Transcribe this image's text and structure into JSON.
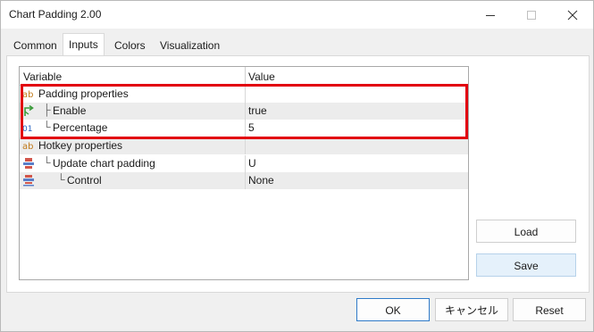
{
  "window": {
    "title": "Chart Padding 2.00"
  },
  "tabs": [
    {
      "label": "Common"
    },
    {
      "label": "Inputs"
    },
    {
      "label": "Colors"
    },
    {
      "label": "Visualization"
    }
  ],
  "grid": {
    "columns": [
      "Variable",
      "Value"
    ],
    "rows": [
      {
        "tree": "",
        "label": "Padding properties",
        "value": "",
        "icon": "ab-icon"
      },
      {
        "tree": "├",
        "label": "Enable",
        "value": "true",
        "icon": "bool-arrow-icon"
      },
      {
        "tree": "└",
        "label": "Percentage",
        "value": "5",
        "icon": "number-01-icon"
      },
      {
        "tree": "",
        "label": "Hotkey properties",
        "value": "",
        "icon": "ab-icon"
      },
      {
        "tree": "└",
        "label": "Update chart padding",
        "value": "U",
        "icon": "enum-list-icon"
      },
      {
        "tree": "└",
        "label": "Control",
        "value": "None",
        "icon": "enum-list-icon"
      }
    ]
  },
  "side_buttons": {
    "load": "Load",
    "save": "Save"
  },
  "footer_buttons": {
    "ok": "OK",
    "cancel": "キャンセル",
    "reset": "Reset"
  },
  "colors": {
    "highlight": "#e2000f",
    "ab_icon": "#c07a1a",
    "bool_icon": "#3a9a3a",
    "number_icon": "#1f5fbf"
  }
}
